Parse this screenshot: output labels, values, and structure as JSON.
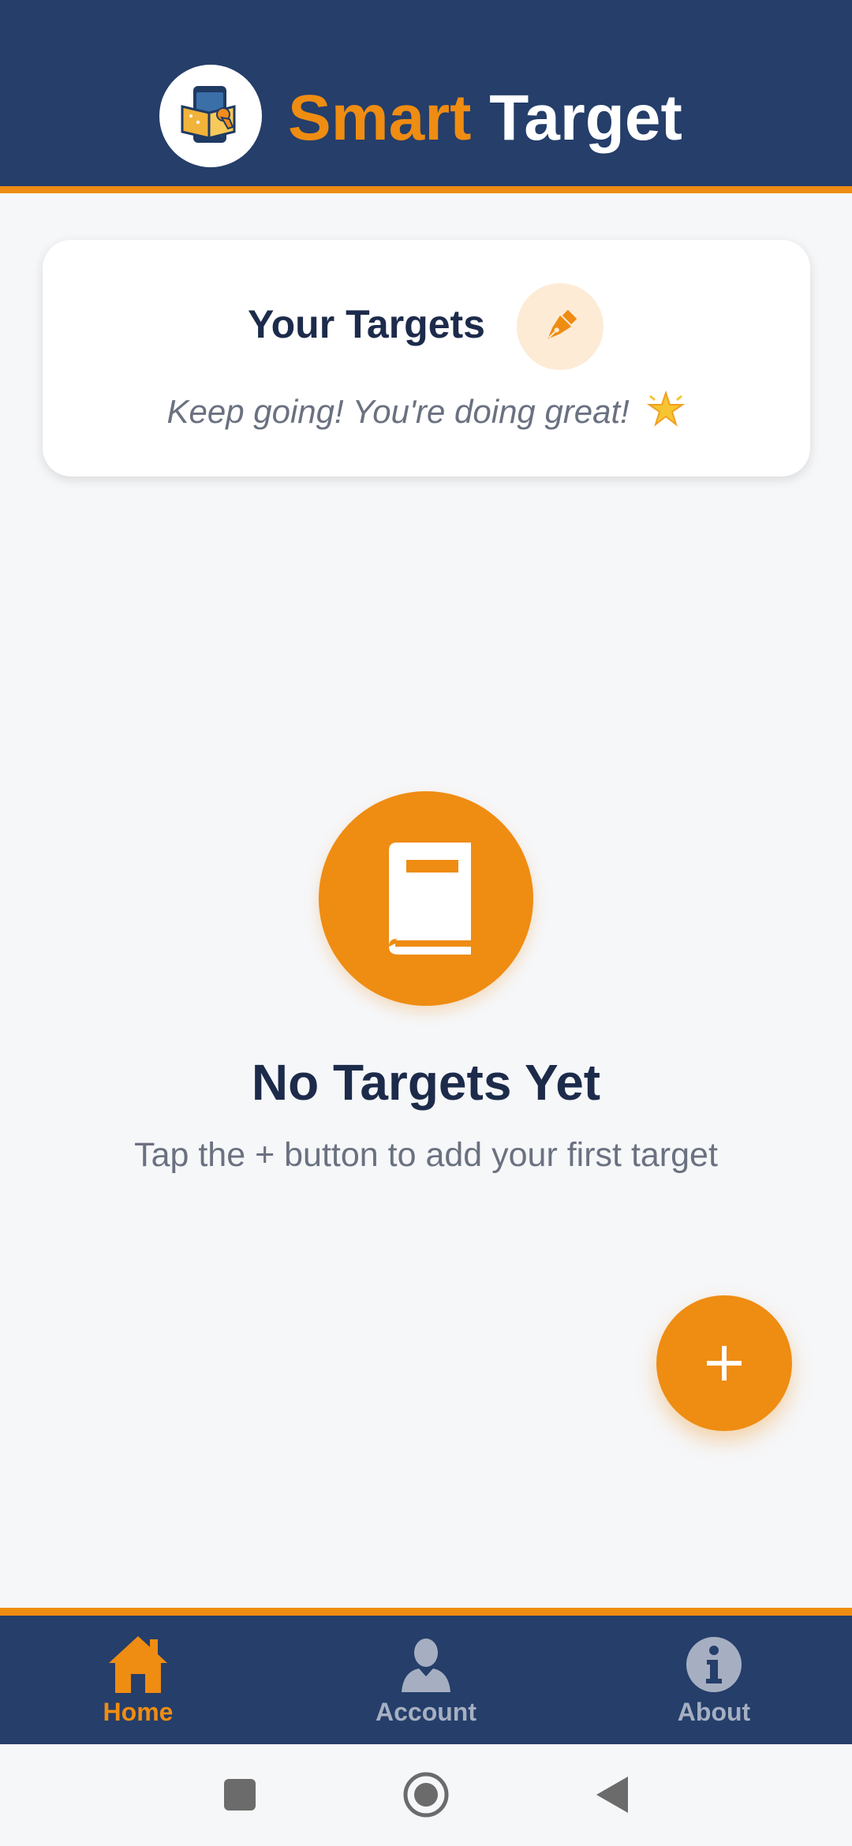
{
  "header": {
    "title_part1": "Smart",
    "title_part2": "Target",
    "logo_icon": "phone-book-logo-icon"
  },
  "targets_card": {
    "title": "Your Targets",
    "subtitle": "Keep going! You're doing great!",
    "badge_icon": "pen-nib-icon",
    "emoji_icon": "glowing-star-icon"
  },
  "empty_state": {
    "icon": "book-icon",
    "title": "No Targets Yet",
    "subtitle": "Tap the + button to add your first target"
  },
  "fab": {
    "icon": "plus-icon"
  },
  "bottom_nav": {
    "items": [
      {
        "label": "Home",
        "icon": "home-icon",
        "active": true
      },
      {
        "label": "Account",
        "icon": "user-icon",
        "active": false
      },
      {
        "label": "About",
        "icon": "info-icon",
        "active": false
      }
    ]
  },
  "system_nav": {
    "buttons": [
      "recents-square-icon",
      "home-circle-icon",
      "back-triangle-icon"
    ]
  },
  "colors": {
    "primary_navy": "#253e6a",
    "accent_orange": "#ef8c12",
    "text_dark": "#1d2b4b",
    "text_muted": "#6a7180",
    "nav_inactive": "#a6afc2",
    "background": "#f6f7f9"
  }
}
